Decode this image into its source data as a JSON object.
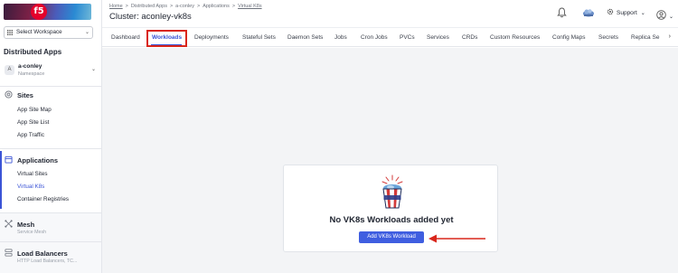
{
  "brand": {
    "logo_text": "f5"
  },
  "workspace": {
    "label": "Select Workspace"
  },
  "sidebar": {
    "title": "Distributed Apps",
    "namespace": {
      "avatar": "A",
      "name": "a-conley",
      "sub": "Namespace"
    },
    "sites": {
      "label": "Sites",
      "items": [
        "App Site Map",
        "App Site List",
        "App Traffic"
      ]
    },
    "applications": {
      "label": "Applications",
      "items": [
        "Virtual Sites",
        "Virtual K8s",
        "Container Registries"
      ],
      "active_index": 1
    },
    "mesh": {
      "label": "Mesh",
      "sub": "Service Mesh"
    },
    "load_balancers": {
      "label": "Load Balancers",
      "sub": "HTTP Load Balancers, TC..."
    }
  },
  "header": {
    "breadcrumbs": [
      "Home",
      "Distributed Apps",
      "a-conley",
      "Applications",
      "Virtual K8s"
    ],
    "separator": ">",
    "title": "Cluster: aconley-vk8s",
    "support_label": "Support"
  },
  "tabs": {
    "items": [
      "Dashboard",
      "Workloads",
      "Deployments",
      "Stateful Sets",
      "Daemon Sets",
      "Jobs",
      "Cron Jobs",
      "PVCs",
      "Services",
      "CRDs",
      "Custom Resources",
      "Config Maps",
      "Secrets",
      "Replica Se"
    ],
    "active": "Workloads"
  },
  "empty_state": {
    "title": "No VK8s Workloads added yet",
    "button": "Add VK8s Workload"
  },
  "colors": {
    "accent": "#3b54d6",
    "highlight": "#d9261c",
    "button": "#3f5ee0"
  }
}
